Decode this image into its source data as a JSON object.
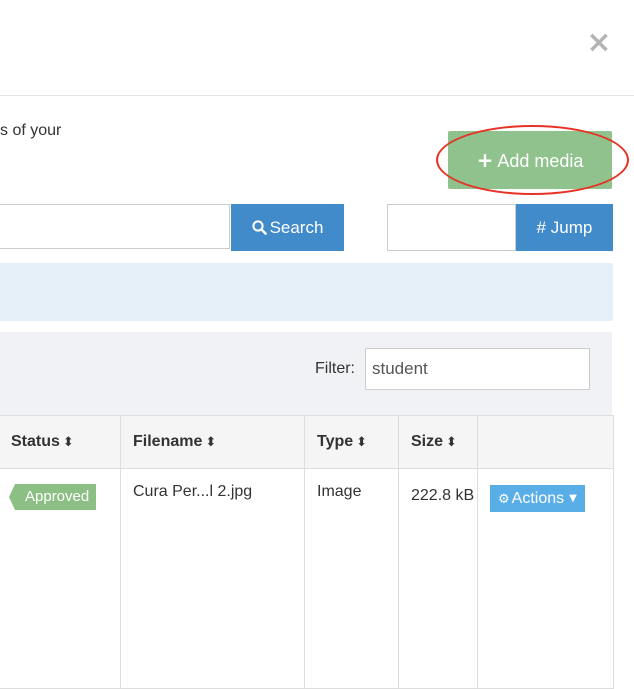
{
  "modal": {
    "close_symbol": "×",
    "intro_text": "s of your"
  },
  "toolbar": {
    "add_media_label": "Add media",
    "add_media_icon": "plus-icon",
    "search_label": "Search",
    "search_icon": "magnifier-icon",
    "search_value": "",
    "jump_label": "# Jump",
    "jump_value": ""
  },
  "filter": {
    "label": "Filter:",
    "value": "student"
  },
  "table": {
    "columns": [
      {
        "label": "Status",
        "sortable": true
      },
      {
        "label": "Filename",
        "sortable": true
      },
      {
        "label": "Type",
        "sortable": true
      },
      {
        "label": "Size",
        "sortable": true
      },
      {
        "label": "",
        "sortable": false
      }
    ],
    "sort_symbol": "⬍",
    "rows": [
      {
        "status": "Approved",
        "filename": "Cura Per...l 2.jpg",
        "type": "Image",
        "size": "222.8 kB",
        "actions_label": "Actions"
      }
    ]
  },
  "colors": {
    "primary_blue": "#418bca",
    "add_green": "#8fc28c",
    "status_green": "#8cbf84",
    "actions_blue": "#5aaee7",
    "annotation_red": "#e53325",
    "info_bar": "#e6f0f8"
  }
}
